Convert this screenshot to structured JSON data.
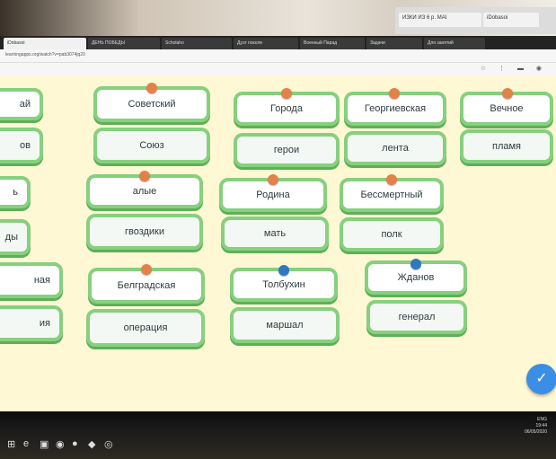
{
  "background_browser": {
    "tabs": [
      "ИЗКИ ИЗ 6 р. MAI",
      "iDobasoi"
    ]
  },
  "browser": {
    "tabs": [
      {
        "label": "iDobasoi",
        "active": true
      },
      {
        "label": "ДЕНЬ ПОБЕДЫ",
        "active": false
      },
      {
        "label": "Scholaho",
        "active": false
      },
      {
        "label": "Дуэт поколе",
        "active": false
      },
      {
        "label": "Военный Парад",
        "active": false
      },
      {
        "label": "Задачи",
        "active": false
      },
      {
        "label": "Для занятий",
        "active": false
      }
    ],
    "url": "learningapps.org/watch?v=pab3074jq20"
  },
  "cards": {
    "c1_left": "ай",
    "c1_right": "ов",
    "c2_left": "Советский",
    "c2_right": "Союз",
    "c3_left": "Города",
    "c3_right": "герои",
    "c4_left": "Георгиевская",
    "c4_right": "лента",
    "c5_left": "Вечное",
    "c5_right": "пламя",
    "r2_1_left": "ь",
    "r2_1_right": "ды",
    "r2_2_left": "алые",
    "r2_2_right": "гвоздики",
    "r2_3_left": "Родина",
    "r2_3_right": "мать",
    "r2_4_left": "Бессмертный",
    "r2_4_right": "полк",
    "r3_1_left": "ная",
    "r3_1_right": "ия",
    "r3_2_left": "Белградская",
    "r3_2_right": "операция",
    "r3_3_left": "Толбухин",
    "r3_3_right": "маршал",
    "r3_4_left": "Жданов",
    "r3_4_right": "генерал"
  },
  "colors": {
    "card_border": "#86d07e",
    "pin_orange": "#e4814a",
    "pin_blue": "#2f78c0",
    "check_button": "#3a8ee6"
  },
  "check_button_icon": "check-icon",
  "taskbar": {
    "tray_lang": "ENG",
    "tray_time": "19:44",
    "tray_date": "06/05/2020"
  }
}
